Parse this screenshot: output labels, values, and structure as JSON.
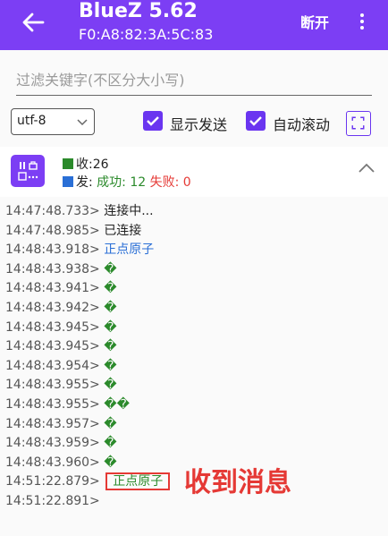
{
  "header": {
    "title": "BlueZ 5.62",
    "subtitle": "F0:A8:82:3A:5C:83",
    "disconnect_label": "断开"
  },
  "filter": {
    "placeholder": "过滤关键字(不区分大小写)"
  },
  "options": {
    "encoding": "utf-8",
    "show_sent_label": "显示发送",
    "auto_scroll_label": "自动滚动",
    "show_sent_checked": true,
    "auto_scroll_checked": true
  },
  "stats": {
    "recv_label": "收:",
    "recv_count": "26",
    "send_label": "发:",
    "success_label": "成功:",
    "success_count": "12",
    "fail_label": "失败:",
    "fail_count": "0"
  },
  "colors": {
    "accent": "#7c3ef4",
    "recv": "#2b8a2b",
    "send": "#2a6fd6",
    "fail": "#e53935"
  },
  "log": [
    {
      "ts": "14:47:48.733>",
      "msg": "连接中...",
      "kind": "plain"
    },
    {
      "ts": "14:47:48.985>",
      "msg": "已连接",
      "kind": "plain"
    },
    {
      "ts": "14:48:43.918>",
      "msg": "正点原子",
      "kind": "blue"
    },
    {
      "ts": "14:48:43.938>",
      "msg": "�",
      "kind": "green"
    },
    {
      "ts": "14:48:43.941>",
      "msg": "�",
      "kind": "green"
    },
    {
      "ts": "14:48:43.942>",
      "msg": "�",
      "kind": "green"
    },
    {
      "ts": "14:48:43.945>",
      "msg": "�",
      "kind": "green"
    },
    {
      "ts": "14:48:43.945>",
      "msg": "�",
      "kind": "green"
    },
    {
      "ts": "14:48:43.954>",
      "msg": "�",
      "kind": "green"
    },
    {
      "ts": "14:48:43.955>",
      "msg": "�",
      "kind": "green"
    },
    {
      "ts": "14:48:43.955>",
      "msg": "��",
      "kind": "green"
    },
    {
      "ts": "14:48:43.957>",
      "msg": "�",
      "kind": "green"
    },
    {
      "ts": "14:48:43.959>",
      "msg": "�",
      "kind": "green"
    },
    {
      "ts": "14:48:43.960>",
      "msg": "�",
      "kind": "green"
    },
    {
      "ts": "14:51:22.879>",
      "msg": "正点原子",
      "kind": "green-boxed"
    },
    {
      "ts": "14:51:22.891>",
      "msg": "",
      "kind": "plain"
    }
  ],
  "annotation": "收到消息"
}
